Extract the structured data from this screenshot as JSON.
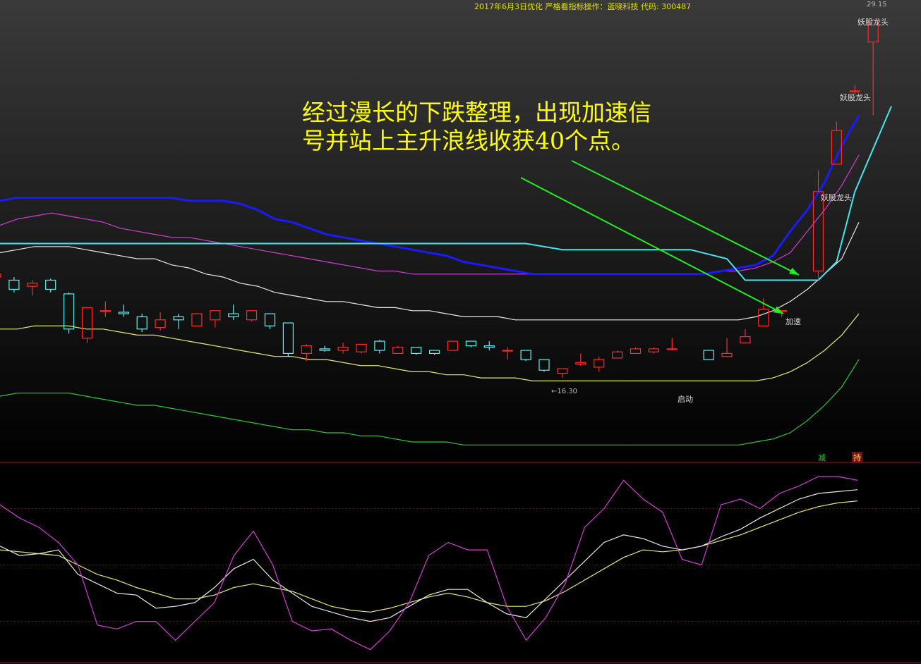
{
  "header": {
    "title": "2017年6月3日优化 严格看指标操作：蓝晓科技 代码: 300487",
    "top_price": "29.15"
  },
  "annotation": {
    "line1": "经过漫长的下跌整理，出现加速信",
    "line2": "号并站上主升浪线收获40个点。"
  },
  "signals": {
    "dragon1": "妖股龙头",
    "dragon2": "妖股龙头",
    "dragon3": "妖股龙头",
    "accelerate": "加速",
    "start": "启动",
    "low_marker": "←16.30"
  },
  "badges": {
    "left": "减",
    "right": "持"
  },
  "colors": {
    "background": "#000000",
    "up_candle": "#ff2a2a",
    "down_candle": "#5ff0f0",
    "blue_band": "#1a1aff",
    "magenta_band": "#d040d0",
    "cyan_line": "#40e8f0",
    "white_band": "#e8e8e8",
    "yellow_band": "#e8e870",
    "green_band": "#30c830",
    "arrow": "#22ee22",
    "separator": "#a01818"
  },
  "chart_data": {
    "type": "candlestick",
    "price_range": [
      15.0,
      29.5
    ],
    "candles": [
      {
        "o": 20.7,
        "h": 20.8,
        "l": 20.4,
        "c": 20.8
      },
      {
        "o": 20.6,
        "h": 20.7,
        "l": 20.2,
        "c": 20.3
      },
      {
        "o": 20.4,
        "h": 20.6,
        "l": 20.1,
        "c": 20.5
      },
      {
        "o": 20.6,
        "h": 20.65,
        "l": 20.2,
        "c": 20.3
      },
      {
        "o": 20.15,
        "h": 20.2,
        "l": 18.85,
        "c": 19.0
      },
      {
        "o": 18.7,
        "h": 19.7,
        "l": 18.55,
        "c": 19.7
      },
      {
        "o": 19.6,
        "h": 19.9,
        "l": 19.4,
        "c": 19.6
      },
      {
        "o": 19.55,
        "h": 19.8,
        "l": 19.4,
        "c": 19.5
      },
      {
        "o": 19.4,
        "h": 19.5,
        "l": 18.9,
        "c": 19.0
      },
      {
        "o": 19.05,
        "h": 19.55,
        "l": 18.95,
        "c": 19.3
      },
      {
        "o": 19.4,
        "h": 19.5,
        "l": 19.0,
        "c": 19.3
      },
      {
        "o": 19.1,
        "h": 19.5,
        "l": 19.1,
        "c": 19.5
      },
      {
        "o": 19.3,
        "h": 19.6,
        "l": 19.05,
        "c": 19.6
      },
      {
        "o": 19.5,
        "h": 19.8,
        "l": 19.3,
        "c": 19.4
      },
      {
        "o": 19.3,
        "h": 19.6,
        "l": 19.25,
        "c": 19.6
      },
      {
        "o": 19.5,
        "h": 19.5,
        "l": 19.0,
        "c": 19.1
      },
      {
        "o": 19.2,
        "h": 19.2,
        "l": 18.1,
        "c": 18.2
      },
      {
        "o": 18.2,
        "h": 18.5,
        "l": 17.95,
        "c": 18.45
      },
      {
        "o": 18.35,
        "h": 18.45,
        "l": 18.25,
        "c": 18.3
      },
      {
        "o": 18.3,
        "h": 18.55,
        "l": 18.2,
        "c": 18.4
      },
      {
        "o": 18.25,
        "h": 18.5,
        "l": 18.2,
        "c": 18.5
      },
      {
        "o": 18.6,
        "h": 18.65,
        "l": 18.2,
        "c": 18.3
      },
      {
        "o": 18.2,
        "h": 18.45,
        "l": 18.2,
        "c": 18.4
      },
      {
        "o": 18.4,
        "h": 18.4,
        "l": 18.15,
        "c": 18.2
      },
      {
        "o": 18.3,
        "h": 18.3,
        "l": 18.15,
        "c": 18.2
      },
      {
        "o": 18.3,
        "h": 18.6,
        "l": 18.3,
        "c": 18.6
      },
      {
        "o": 18.6,
        "h": 18.6,
        "l": 18.4,
        "c": 18.45
      },
      {
        "o": 18.45,
        "h": 18.6,
        "l": 18.3,
        "c": 18.4
      },
      {
        "o": 18.3,
        "h": 18.4,
        "l": 18.0,
        "c": 18.3
      },
      {
        "o": 18.3,
        "h": 18.3,
        "l": 17.95,
        "c": 18.0
      },
      {
        "o": 18.0,
        "h": 18.0,
        "l": 17.6,
        "c": 17.65
      },
      {
        "o": 17.55,
        "h": 17.7,
        "l": 17.4,
        "c": 17.7
      },
      {
        "o": 17.85,
        "h": 18.2,
        "l": 17.8,
        "c": 17.9
      },
      {
        "o": 17.75,
        "h": 18.1,
        "l": 17.6,
        "c": 18.0
      },
      {
        "o": 18.05,
        "h": 18.3,
        "l": 18.05,
        "c": 18.25
      },
      {
        "o": 18.2,
        "h": 18.4,
        "l": 18.2,
        "c": 18.35
      },
      {
        "o": 18.25,
        "h": 18.4,
        "l": 18.2,
        "c": 18.35
      },
      {
        "o": 18.35,
        "h": 18.7,
        "l": 18.3,
        "c": 18.35
      },
      null,
      {
        "o": 18.3,
        "h": 18.3,
        "l": 18.0,
        "c": 18.0
      },
      {
        "o": 18.1,
        "h": 18.7,
        "l": 18.1,
        "c": 18.2
      },
      {
        "o": 18.55,
        "h": 19.0,
        "l": 18.55,
        "c": 18.75
      },
      {
        "o": 19.1,
        "h": 20.0,
        "l": 19.1,
        "c": 19.65
      },
      {
        "o": 19.6,
        "h": 19.6,
        "l": 19.4,
        "c": 19.6
      },
      null,
      {
        "o": 20.9,
        "h": 24.2,
        "l": 20.6,
        "c": 23.5
      },
      {
        "o": 24.4,
        "h": 25.8,
        "l": 24.4,
        "c": 25.5
      },
      {
        "o": 26.8,
        "h": 27.0,
        "l": 26.7,
        "c": 26.8
      },
      {
        "o": 28.4,
        "h": 29.15,
        "l": 26.0,
        "c": 29.1
      }
    ],
    "bands": {
      "blue": [
        23.2,
        23.3,
        23.3,
        23.3,
        23.3,
        23.3,
        23.3,
        23.3,
        23.3,
        23.3,
        23.3,
        23.2,
        23.2,
        23.2,
        23.1,
        22.9,
        22.6,
        22.5,
        22.3,
        22.1,
        22.0,
        21.9,
        21.8,
        21.7,
        21.6,
        21.5,
        21.4,
        21.2,
        21.1,
        21.0,
        20.9,
        20.8,
        20.8,
        20.8,
        20.8,
        20.8,
        20.8,
        20.8,
        20.8,
        20.8,
        20.8,
        20.8,
        20.9,
        21.0,
        21.1,
        21.4,
        22.2,
        22.9,
        23.8,
        25.0,
        26.0
      ],
      "magenta": [
        22.4,
        22.6,
        22.7,
        22.8,
        22.7,
        22.6,
        22.5,
        22.3,
        22.2,
        22.1,
        22.0,
        22.0,
        21.9,
        21.8,
        21.7,
        21.6,
        21.5,
        21.4,
        21.3,
        21.2,
        21.1,
        21.0,
        20.9,
        20.9,
        20.8,
        20.8,
        20.8,
        20.8,
        20.8,
        20.8,
        20.8,
        20.8,
        20.8,
        20.8,
        20.8,
        20.8,
        20.8,
        20.8,
        20.8,
        20.8,
        20.8,
        20.8,
        20.9,
        20.9,
        21.0,
        21.2,
        21.5,
        22.2,
        22.9,
        23.7,
        24.7
      ],
      "white": [
        21.5,
        21.6,
        21.7,
        21.7,
        21.7,
        21.6,
        21.5,
        21.4,
        21.3,
        21.3,
        21.1,
        21.0,
        20.8,
        20.7,
        20.5,
        20.4,
        20.2,
        20.1,
        20.0,
        19.9,
        19.9,
        19.8,
        19.7,
        19.7,
        19.6,
        19.6,
        19.5,
        19.4,
        19.4,
        19.4,
        19.3,
        19.3,
        19.3,
        19.3,
        19.3,
        19.3,
        19.3,
        19.3,
        19.3,
        19.3,
        19.3,
        19.3,
        19.3,
        19.3,
        19.4,
        19.6,
        19.9,
        20.3,
        20.8,
        21.3,
        22.5
      ],
      "yellow": [
        19.0,
        19.0,
        19.1,
        19.1,
        19.1,
        19.0,
        19.0,
        18.9,
        18.8,
        18.8,
        18.7,
        18.6,
        18.5,
        18.4,
        18.3,
        18.2,
        18.1,
        18.1,
        18.0,
        18.0,
        17.9,
        17.8,
        17.8,
        17.7,
        17.6,
        17.6,
        17.5,
        17.5,
        17.4,
        17.4,
        17.4,
        17.3,
        17.3,
        17.3,
        17.3,
        17.3,
        17.3,
        17.3,
        17.3,
        17.3,
        17.3,
        17.3,
        17.3,
        17.3,
        17.3,
        17.4,
        17.6,
        17.9,
        18.3,
        18.8,
        19.5
      ],
      "green": [
        16.8,
        16.9,
        16.9,
        16.9,
        16.9,
        16.8,
        16.7,
        16.6,
        16.5,
        16.5,
        16.4,
        16.3,
        16.2,
        16.1,
        16.0,
        15.9,
        15.8,
        15.7,
        15.7,
        15.6,
        15.6,
        15.5,
        15.5,
        15.4,
        15.3,
        15.3,
        15.3,
        15.2,
        15.2,
        15.2,
        15.2,
        15.2,
        15.2,
        15.2,
        15.2,
        15.2,
        15.2,
        15.2,
        15.2,
        15.2,
        15.2,
        15.2,
        15.2,
        15.2,
        15.3,
        15.4,
        15.6,
        16.0,
        16.5,
        17.1,
        18.0
      ],
      "cyan_steps": [
        [
          0,
          21.8
        ],
        [
          29,
          21.8
        ],
        [
          31,
          21.6
        ],
        [
          38,
          21.6
        ],
        [
          40,
          21.3
        ],
        [
          41,
          20.6
        ],
        [
          45,
          20.6
        ],
        [
          46,
          21.2
        ],
        [
          47,
          23.5
        ],
        [
          48,
          24.9
        ],
        [
          49,
          26.3
        ]
      ]
    },
    "oscillator": {
      "range": [
        0,
        100
      ],
      "magenta": [
        82,
        75,
        70,
        62,
        50,
        18,
        16,
        20,
        20,
        10,
        20,
        30,
        55,
        68,
        50,
        20,
        15,
        16,
        10,
        5,
        15,
        30,
        55,
        62,
        58,
        58,
        28,
        10,
        22,
        40,
        70,
        80,
        95,
        85,
        78,
        53,
        50,
        82,
        85,
        80,
        88,
        92,
        97,
        97,
        95
      ],
      "white": [
        60,
        55,
        56,
        58,
        45,
        40,
        35,
        34,
        27,
        28,
        30,
        38,
        48,
        53,
        42,
        35,
        28,
        25,
        22,
        20,
        22,
        28,
        34,
        37,
        37,
        30,
        24,
        22,
        32,
        42,
        52,
        62,
        66,
        64,
        60,
        58,
        60,
        65,
        69,
        75,
        80,
        85,
        88,
        89,
        90
      ],
      "yellow": [
        58,
        57,
        56,
        55,
        50,
        45,
        42,
        38,
        35,
        32,
        32,
        34,
        38,
        40,
        38,
        36,
        32,
        28,
        26,
        25,
        27,
        30,
        33,
        35,
        33,
        30,
        28,
        28,
        31,
        36,
        42,
        48,
        54,
        58,
        57,
        58,
        60,
        63,
        66,
        70,
        74,
        78,
        81,
        83,
        84
      ]
    }
  }
}
